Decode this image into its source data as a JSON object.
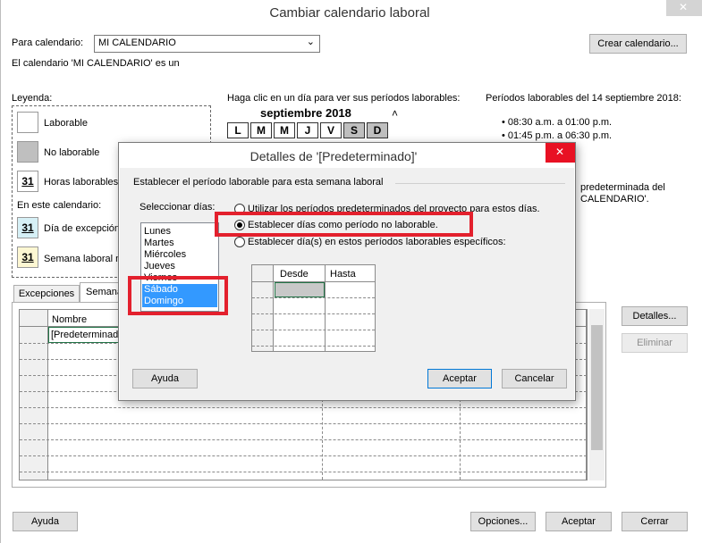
{
  "window": {
    "title": "Cambiar calendario laboral",
    "close_glyph": "✕"
  },
  "main": {
    "para_calendario_label": "Para calendario:",
    "calendar_value": "MI CALENDARIO",
    "crear_button": "Crear calendario...",
    "info_text": "El calendario 'MI CALENDARIO' es un",
    "legend_title": "Leyenda:",
    "legend": {
      "laborable": "Laborable",
      "no_laborable": "No laborable",
      "horas": "Horas laborables",
      "en_este": "En este calendario:",
      "excepcion": "Día de excepción",
      "semana": "Semana laboral n",
      "day_num": "31"
    },
    "click_text": "Haga clic en un día para ver sus períodos laborables:",
    "month_title": "septiembre 2018",
    "weekdays": [
      "L",
      "M",
      "M",
      "J",
      "V",
      "S",
      "D"
    ],
    "periods_title": "Períodos laborables del 14 septiembre 2018:",
    "periods": [
      "• 08:30 a.m. a 01:00 p.m.",
      "• 01:45 p.m. a 06:30 p.m."
    ],
    "side_text_1": "predeterminada del",
    "side_text_2": "CALENDARIO'.",
    "tabs": [
      "Excepciones",
      "Semana"
    ],
    "table_header": "Nombre",
    "table_row": "[Predeterminado]",
    "detalles_button": "Detalles...",
    "eliminar_button": "Eliminar",
    "footer": {
      "ayuda": "Ayuda",
      "opciones": "Opciones...",
      "aceptar": "Aceptar",
      "cerrar": "Cerrar"
    }
  },
  "dialog": {
    "title": "Detalles de '[Predeterminado]'",
    "group_label": "Establecer el período laborable para esta semana laboral",
    "seleccionar_label": "Seleccionar días:",
    "days": [
      "Lunes",
      "Martes",
      "Miércoles",
      "Jueves",
      "Viernes",
      "Sábado",
      "Domingo"
    ],
    "selected_days": [
      "Sábado",
      "Domingo"
    ],
    "options": [
      "Utilizar los períodos predeterminados del proyecto para estos días.",
      "Establecer días como período no laborable.",
      "Establecer día(s) en estos períodos laborables específicos:"
    ],
    "selected_option": 1,
    "grid_headers": [
      "Desde",
      "Hasta"
    ],
    "ayuda": "Ayuda",
    "aceptar": "Aceptar",
    "cancelar": "Cancelar"
  },
  "colors": {
    "selection": "#3399ff",
    "highlight": "#e3202d",
    "accent": "#0078d7"
  }
}
